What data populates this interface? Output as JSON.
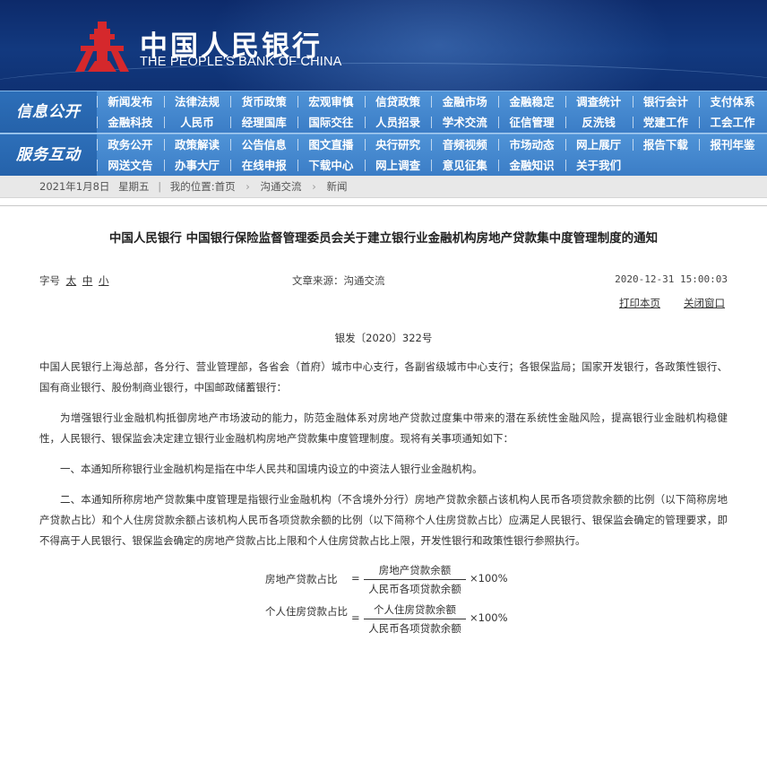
{
  "header": {
    "cn_name": "中国人民银行",
    "en_name": "THE PEOPLE'S BANK OF CHINA",
    "emblem_color": "#d5282c",
    "bg_color": "#12397f"
  },
  "nav": {
    "info": {
      "title": "信息公开",
      "row1": [
        "新闻发布",
        "法律法规",
        "货币政策",
        "宏观审慎",
        "信贷政策",
        "金融市场",
        "金融稳定",
        "调查统计",
        "银行会计",
        "支付体系"
      ],
      "row2": [
        "金融科技",
        "人民币",
        "经理国库",
        "国际交往",
        "人员招录",
        "学术交流",
        "征信管理",
        "反洗钱",
        "党建工作",
        "工会工作"
      ]
    },
    "service": {
      "title": "服务互动",
      "row1": [
        "政务公开",
        "政策解读",
        "公告信息",
        "图文直播",
        "央行研究",
        "音频视频",
        "市场动态",
        "网上展厅",
        "报告下载",
        "报刊年鉴"
      ],
      "row2": [
        "网送文告",
        "办事大厅",
        "在线申报",
        "下载中心",
        "网上调查",
        "意见征集",
        "金融知识",
        "关于我们"
      ]
    }
  },
  "breadcrumb": {
    "date": "2021年1月8日",
    "weekday": "星期五",
    "location_label": "我的位置:首页",
    "level1": "沟通交流",
    "level2": "新闻"
  },
  "article": {
    "title": "中国人民银行 中国银行保险监督管理委员会关于建立银行业金融机构房地产贷款集中度管理制度的通知",
    "font_size_label": "字号",
    "font_sizes": [
      "太",
      "中",
      "小"
    ],
    "source": "文章来源：沟通交流",
    "datetime": "2020-12-31 15:00:03",
    "print_label": "打印本页",
    "close_label": "关闭窗口",
    "doc_number": "银发〔2020〕322号",
    "paragraphs": [
      "中国人民银行上海总部，各分行、营业管理部，各省会（首府）城市中心支行，各副省级城市中心支行；各银保监局；国家开发银行，各政策性银行、国有商业银行、股份制商业银行，中国邮政储蓄银行：",
      "为增强银行业金融机构抵御房地产市场波动的能力，防范金融体系对房地产贷款过度集中带来的潜在系统性金融风险，提高银行业金融机构稳健性，人民银行、银保监会决定建立银行业金融机构房地产贷款集中度管理制度。现将有关事项通知如下：",
      "一、本通知所称银行业金融机构是指在中华人民共和国境内设立的中资法人银行业金融机构。",
      "二、本通知所称房地产贷款集中度管理是指银行业金融机构（不含境外分行）房地产贷款余额占该机构人民币各项贷款余额的比例（以下简称房地产贷款占比）和个人住房贷款余额占该机构人民币各项贷款余额的比例（以下简称个人住房贷款占比）应满足人民银行、银保监会确定的管理要求，即不得高于人民银行、银保监会确定的房地产贷款占比上限和个人住房贷款占比上限，开发性银行和政策性银行参照执行。"
    ],
    "formulas": [
      {
        "lhs": "房地产贷款占比",
        "eq": "=",
        "numerator": "房地产贷款余额",
        "denominator": "人民币各项贷款余额",
        "multiplier": "×100%"
      },
      {
        "lhs": "个人住房贷款占比",
        "eq": "=",
        "numerator": "个人住房贷款余额",
        "denominator": "人民币各项贷款余额",
        "multiplier": "×100%"
      }
    ]
  }
}
